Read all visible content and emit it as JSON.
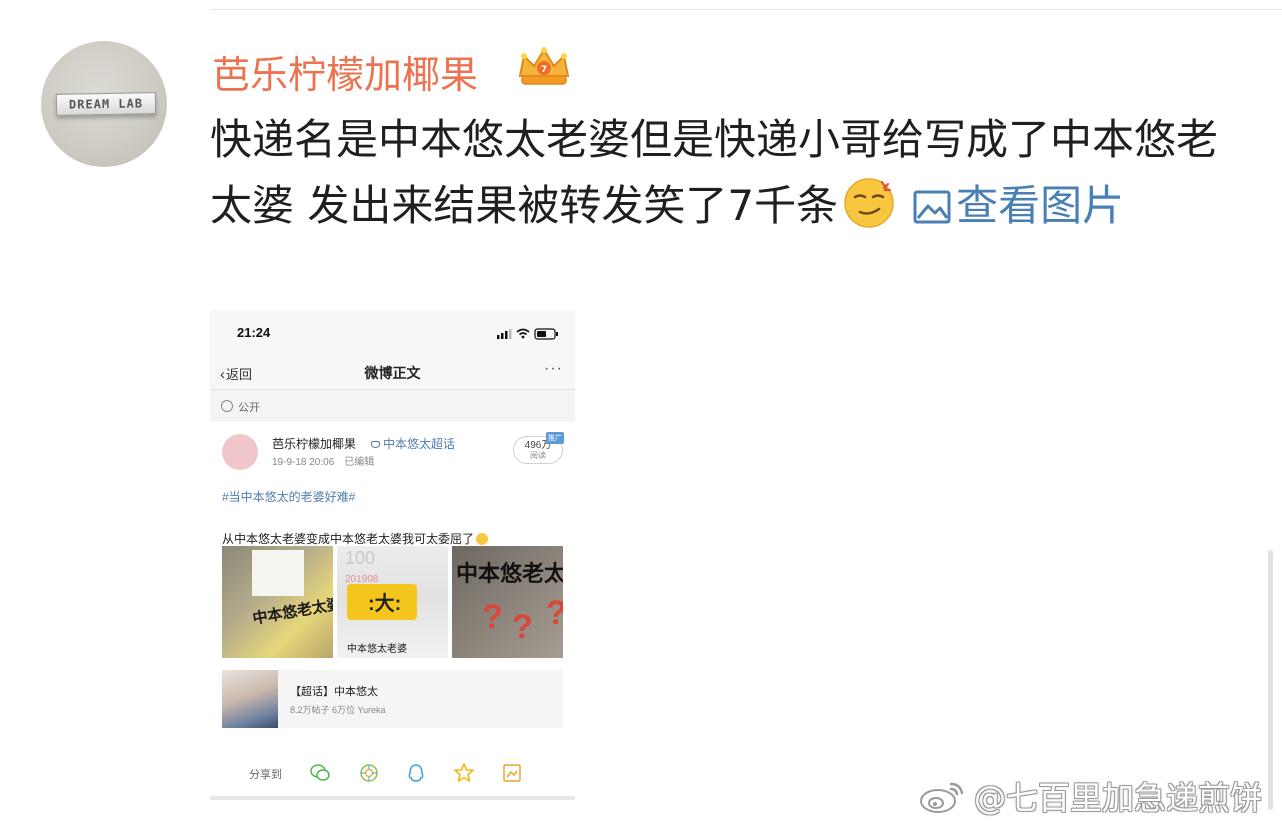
{
  "post": {
    "author": "芭乐柠檬加椰果",
    "author_badge_icon": "crown-icon",
    "text_part1": "快递名是中本悠太老婆但是快递小哥给写成了中本悠老太婆 发出来结果被转发笑了7千条",
    "emoji_icon": "smirk-emoji-icon",
    "view_image_link": "查看图片"
  },
  "avatar": {
    "text": "DREAM LAB"
  },
  "screenshot": {
    "status_time": "21:24",
    "nav": {
      "back_label": "返回",
      "title": "微博正文",
      "more": "···"
    },
    "visibility": "公开",
    "card": {
      "author": "芭乐柠檬加椰果",
      "super_topic_tag": "中本悠太超话",
      "timestamp": "19-9-18 20:06",
      "edited": "已编辑",
      "reads_count": "496万",
      "reads_label": "阅读",
      "reads_badge": "推广",
      "hashtag": "#当中本悠太的老婆好难#",
      "body": "从中本悠太老婆变成中本悠老太婆我可太委屈了",
      "thumb1_handwriting": "中本悠老太婆",
      "thumb2_number": "100",
      "thumb2_code": "201908",
      "thumb2_handwriting": "中本悠太老婆",
      "thumb3_handwriting": "中本悠老太",
      "supertopic_name": "【超话】中本悠太",
      "supertopic_stats": "8.2万帖子 6万位 Yureka"
    },
    "share": {
      "label": "分享到",
      "targets": [
        "wechat-icon",
        "moments-icon",
        "qq-icon",
        "qzone-icon",
        "save-image-icon"
      ]
    }
  },
  "watermark": {
    "text": "@七百里加急递煎饼"
  },
  "colors": {
    "username": "#eb7350",
    "link": "#4a7fb5",
    "text": "#1f1f1f"
  }
}
